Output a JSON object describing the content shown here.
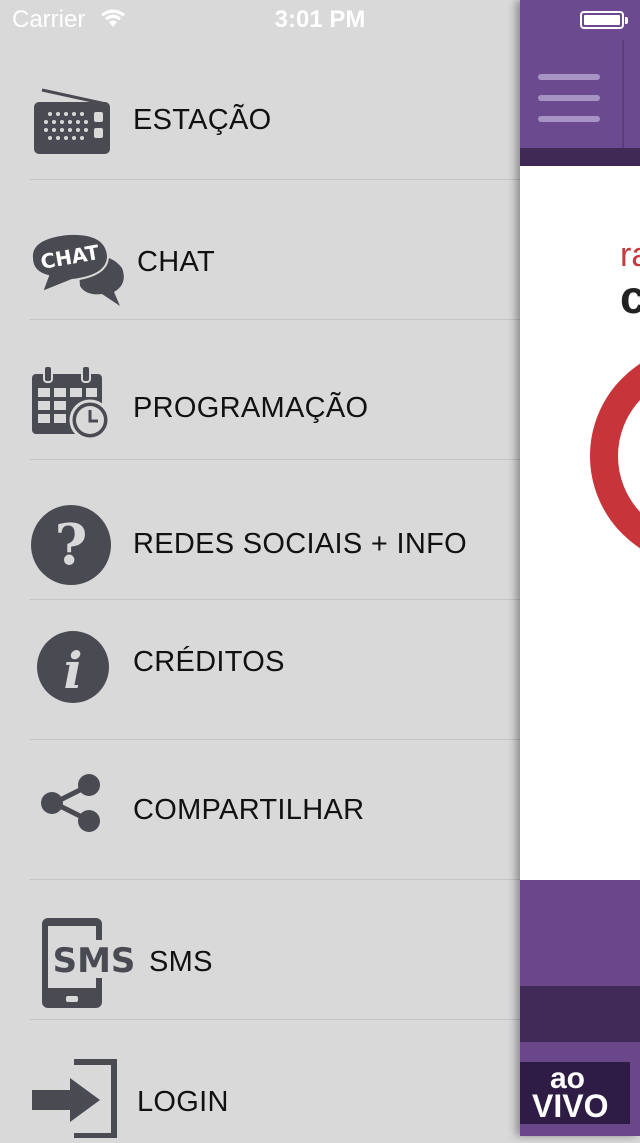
{
  "status_bar": {
    "carrier": "Carrier",
    "time": "3:01 PM"
  },
  "menu": {
    "items": [
      {
        "label": "ESTAÇÃO",
        "icon": "radio-icon"
      },
      {
        "label": "CHAT",
        "icon": "chat-bubble-icon"
      },
      {
        "label": "PROGRAMAÇÃO",
        "icon": "calendar-clock-icon"
      },
      {
        "label": "REDES SOCIAIS + INFO",
        "icon": "question-icon"
      },
      {
        "label": "CRÉDITOS",
        "icon": "info-icon"
      },
      {
        "label": "COMPARTILHAR",
        "icon": "share-icon"
      },
      {
        "label": "SMS",
        "icon": "sms-phone-icon"
      },
      {
        "label": "LOGIN",
        "icon": "login-icon"
      }
    ],
    "chat_icon_text": "CHAT",
    "sms_icon_text": "SMS"
  },
  "app": {
    "logo_line1": "ra",
    "logo_line2": "c",
    "live_line1": "ao",
    "live_line2": "VIVO"
  },
  "colors": {
    "menu_bg": "#d9d9d9",
    "header_purple": "#6b4a8f",
    "accent_red": "#c7343a",
    "icon_dark": "#4a4a52"
  }
}
